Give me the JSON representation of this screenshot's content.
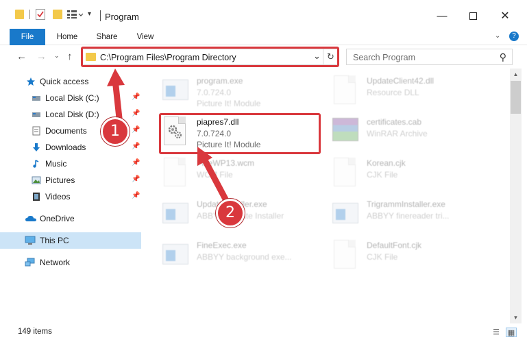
{
  "window": {
    "title": "Program",
    "minimize_icon": "minimize-icon",
    "maximize_icon": "maximize-icon",
    "close_icon": "close-icon"
  },
  "ribbon": {
    "tabs": [
      {
        "label": "File"
      },
      {
        "label": "Home"
      },
      {
        "label": "Share"
      },
      {
        "label": "View"
      }
    ]
  },
  "address": {
    "path": "C:\\Program Files\\Program Directory"
  },
  "search": {
    "placeholder": "Search Program"
  },
  "sidebar": {
    "items": [
      {
        "label": "Quick access",
        "icon": "star-icon"
      },
      {
        "label": "Local Disk (C:)",
        "icon": "drive-icon"
      },
      {
        "label": "Local Disk (D:)",
        "icon": "drive-icon"
      },
      {
        "label": "Documents",
        "icon": "documents-icon"
      },
      {
        "label": "Downloads",
        "icon": "download-arrow-icon"
      },
      {
        "label": "Music",
        "icon": "music-note-icon"
      },
      {
        "label": "Pictures",
        "icon": "pictures-icon"
      },
      {
        "label": "Videos",
        "icon": "film-icon"
      },
      {
        "label": "OneDrive",
        "icon": "cloud-icon"
      },
      {
        "label": "This PC",
        "icon": "monitor-icon"
      },
      {
        "label": "Network",
        "icon": "network-icon"
      }
    ]
  },
  "files": [
    {
      "name": "program.exe",
      "line2": "7.0.724.0",
      "line3": "Picture It! Module"
    },
    {
      "name": "UpdateClient42.dll",
      "line2": "Resource DLL",
      "line3": ""
    },
    {
      "name": "piapres7.dll",
      "line2": "7.0.724.0",
      "line3": "Picture It! Module"
    },
    {
      "name": "certificates.cab",
      "line2": "WinRAR Archive",
      "line3": ""
    },
    {
      "name": "FineWP13.wcm",
      "line2": "WCM File",
      "line3": ""
    },
    {
      "name": "Korean.cjk",
      "line2": "CJK File",
      "line3": ""
    },
    {
      "name": "UpdateInstaller.exe",
      "line2": "ABBYY Update Installer",
      "line3": ""
    },
    {
      "name": "TrigrammInstaller.exe",
      "line2": "ABBYY finereader tri...",
      "line3": ""
    },
    {
      "name": "FineExec.exe",
      "line2": "ABBYY background exe...",
      "line3": ""
    },
    {
      "name": "DefaultFont.cjk",
      "line2": "CJK File",
      "line3": ""
    }
  ],
  "status": {
    "item_count": "149 items"
  },
  "callouts": {
    "first": "1",
    "second": "2"
  },
  "colors": {
    "accent": "#1979ca",
    "highlight": "#d9383d",
    "selection": "#cce4f7"
  }
}
